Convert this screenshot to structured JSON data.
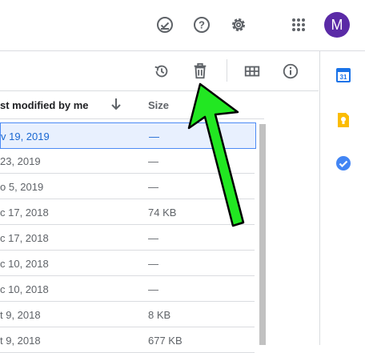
{
  "header": {
    "avatar_letter": "M",
    "icons": [
      "check-circle-icon",
      "help-icon",
      "gear-icon",
      "apps-grid-icon"
    ]
  },
  "toolbar": {
    "icons": [
      "activity-history-icon",
      "trash-icon",
      "grid-view-icon",
      "info-icon"
    ]
  },
  "list": {
    "columns": {
      "modified": "st modified by me",
      "size": "Size"
    },
    "rows": [
      {
        "modified": "v 19, 2019",
        "size": "—",
        "selected": true
      },
      {
        "modified": " 23, 2019",
        "size": "—"
      },
      {
        "modified": "o 5, 2019",
        "size": "—"
      },
      {
        "modified": "c 17, 2018",
        "size": "74 KB"
      },
      {
        "modified": "c 17, 2018",
        "size": "—"
      },
      {
        "modified": "c 10, 2018",
        "size": "—"
      },
      {
        "modified": "c 10, 2018",
        "size": "—"
      },
      {
        "modified": "t 9, 2018",
        "size": "8 KB"
      },
      {
        "modified": "t 9, 2018",
        "size": "677 KB"
      }
    ]
  },
  "side_panel": {
    "apps": [
      "calendar-icon",
      "keep-icon",
      "tasks-icon"
    ],
    "calendar_day": "31"
  },
  "colors": {
    "accent": "#1a73e8",
    "avatar": "#5a2aa6",
    "selected_row": "#e8f0fe",
    "arrow_fill": "#22e722"
  }
}
